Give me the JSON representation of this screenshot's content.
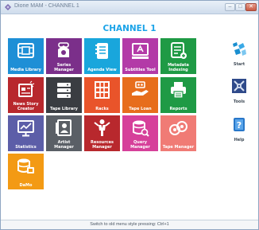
{
  "window": {
    "title": "Dione MAM - CHANNEL 1"
  },
  "header": {
    "channel": "CHANNEL 1"
  },
  "tiles": [
    {
      "label": "Media Library",
      "icon": "media-library-icon",
      "color": "#1e8fd6"
    },
    {
      "label": "Series\nManager",
      "icon": "series-manager-icon",
      "color": "#7b2f8a"
    },
    {
      "label": "Agenda View",
      "icon": "agenda-view-icon",
      "color": "#19a6dc"
    },
    {
      "label": "Subtitles Tool",
      "icon": "subtitles-tool-icon",
      "color": "#b33aa7"
    },
    {
      "label": "Metadata\nIndexing",
      "icon": "metadata-indexing-icon",
      "color": "#1f9a45"
    },
    {
      "label": "News Story\nCreator",
      "icon": "news-story-creator-icon",
      "color": "#b8282d"
    },
    {
      "label": "Tape Library",
      "icon": "tape-library-icon",
      "color": "#3a3d42"
    },
    {
      "label": "Racks",
      "icon": "racks-icon",
      "color": "#e9542a"
    },
    {
      "label": "Tape Loan",
      "icon": "tape-loan-icon",
      "color": "#e76d1c"
    },
    {
      "label": "Reports",
      "icon": "reports-icon",
      "color": "#1f9a45"
    },
    {
      "label": "Statistics",
      "icon": "statistics-icon",
      "color": "#5c5ea8"
    },
    {
      "label": "Artist\nManager",
      "icon": "artist-manager-icon",
      "color": "#5a5f66"
    },
    {
      "label": "Resources\nManager",
      "icon": "resources-manager-icon",
      "color": "#b8282d"
    },
    {
      "label": "Query\nManager",
      "icon": "query-manager-icon",
      "color": "#d6409a"
    },
    {
      "label": "Tape Manager",
      "icon": "tape-manager-icon",
      "color": "#f07b75"
    },
    {
      "label": "DaMo",
      "icon": "damo-icon",
      "color": "#f39a14"
    }
  ],
  "side": [
    {
      "label": "Start",
      "icon": "start-icon"
    },
    {
      "label": "Tools",
      "icon": "tools-icon"
    },
    {
      "label": "Help",
      "icon": "help-icon"
    }
  ],
  "status": {
    "text": "Switch to old menu style pressing: Ctrl+1"
  }
}
